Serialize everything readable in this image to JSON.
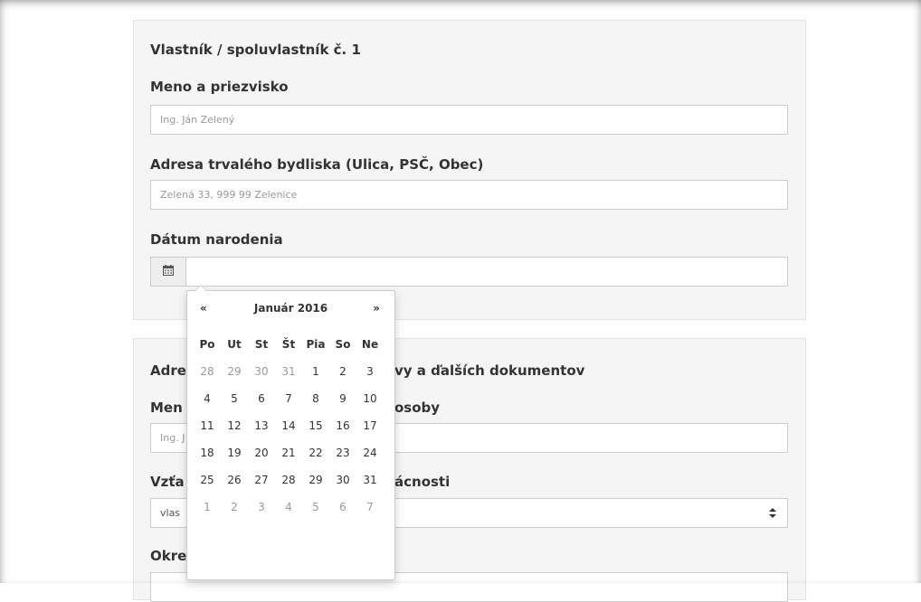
{
  "owner_section": {
    "title": "Vlastník / spoluvlastník č. 1",
    "name_label": "Meno a priezvisko",
    "name_placeholder": "Ing. Ján Zelený",
    "address_label": "Adresa trvalého bydliska (Ulica, PSČ, Obec)",
    "address_placeholder": "Zelená 33, 999 99 Zelenice",
    "birth_label": "Dátum narodenia",
    "birth_value": ""
  },
  "delivery_section": {
    "title_visible": "Adre",
    "title_tail": "vy a ďalších dokumentov",
    "name_label_visible": "Men",
    "name_label_tail": "osoby",
    "name_placeholder_visible": "Ing. J",
    "relation_label_visible": "Vzťa",
    "relation_label_tail": "ácnosti",
    "relation_value_visible": "vlas",
    "district_label_visible": "Okre"
  },
  "datepicker": {
    "prev": "«",
    "next": "»",
    "month_title": "Január 2016",
    "weekdays": [
      "Po",
      "Ut",
      "St",
      "Št",
      "Pia",
      "So",
      "Ne"
    ],
    "weeks": [
      [
        {
          "d": "28",
          "muted": true
        },
        {
          "d": "29",
          "muted": true
        },
        {
          "d": "30",
          "muted": true
        },
        {
          "d": "31",
          "muted": true
        },
        {
          "d": "1",
          "muted": false
        },
        {
          "d": "2",
          "muted": false
        },
        {
          "d": "3",
          "muted": false
        }
      ],
      [
        {
          "d": "4",
          "muted": false
        },
        {
          "d": "5",
          "muted": false
        },
        {
          "d": "6",
          "muted": false
        },
        {
          "d": "7",
          "muted": false
        },
        {
          "d": "8",
          "muted": false
        },
        {
          "d": "9",
          "muted": false
        },
        {
          "d": "10",
          "muted": false
        }
      ],
      [
        {
          "d": "11",
          "muted": false
        },
        {
          "d": "12",
          "muted": false
        },
        {
          "d": "13",
          "muted": false
        },
        {
          "d": "14",
          "muted": false
        },
        {
          "d": "15",
          "muted": false
        },
        {
          "d": "16",
          "muted": false
        },
        {
          "d": "17",
          "muted": false
        }
      ],
      [
        {
          "d": "18",
          "muted": false
        },
        {
          "d": "19",
          "muted": false
        },
        {
          "d": "20",
          "muted": false
        },
        {
          "d": "21",
          "muted": false
        },
        {
          "d": "22",
          "muted": false
        },
        {
          "d": "23",
          "muted": false
        },
        {
          "d": "24",
          "muted": false
        }
      ],
      [
        {
          "d": "25",
          "muted": false
        },
        {
          "d": "26",
          "muted": false
        },
        {
          "d": "27",
          "muted": false
        },
        {
          "d": "28",
          "muted": false
        },
        {
          "d": "29",
          "muted": false
        },
        {
          "d": "30",
          "muted": false
        },
        {
          "d": "31",
          "muted": false
        }
      ],
      [
        {
          "d": "1",
          "muted": true
        },
        {
          "d": "2",
          "muted": true
        },
        {
          "d": "3",
          "muted": true
        },
        {
          "d": "4",
          "muted": true
        },
        {
          "d": "5",
          "muted": true
        },
        {
          "d": "6",
          "muted": true
        },
        {
          "d": "7",
          "muted": true
        }
      ]
    ]
  },
  "icons": {
    "calendar": "calendar-icon",
    "select_arrows": "updown-arrows-icon"
  },
  "colors": {
    "panel_bg": "#f5f5f5",
    "muted_text": "#999999",
    "text": "#333333"
  }
}
